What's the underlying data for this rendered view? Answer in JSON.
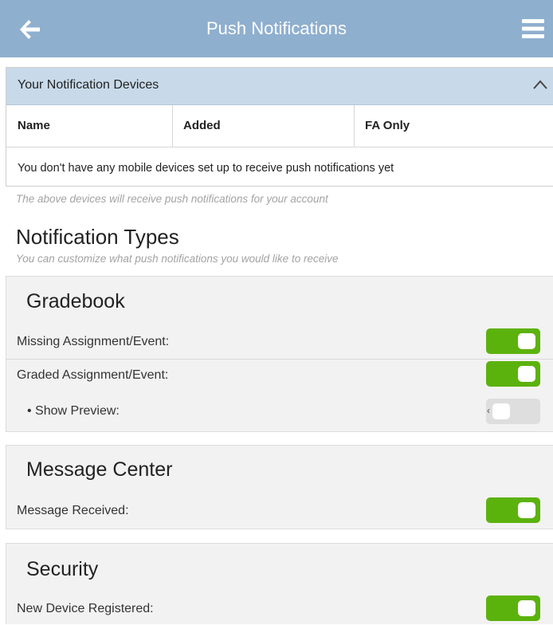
{
  "header": {
    "title": "Push Notifications",
    "back_icon": "arrow-left-icon",
    "menu_icon": "hamburger-menu-icon"
  },
  "devices": {
    "title": "Your Notification Devices",
    "columns": [
      "Name",
      "Added",
      "FA Only"
    ],
    "empty_message": "You don't have any mobile devices set up to receive push notifications yet",
    "note": "The above devices will receive push notifications for your account"
  },
  "notification_types": {
    "title": "Notification Types",
    "subtitle": "You can customize what push notifications you would like to receive"
  },
  "sections": {
    "gradebook": {
      "title": "Gradebook",
      "missing": {
        "label": "Missing Assignment/Event:",
        "enabled": true
      },
      "graded": {
        "label": "Graded Assignment/Event:",
        "enabled": true
      },
      "preview": {
        "label": "• Show Preview:",
        "enabled": false
      }
    },
    "message_center": {
      "title": "Message Center",
      "received": {
        "label": "Message Received:",
        "enabled": true
      }
    },
    "security": {
      "title": "Security",
      "new_device": {
        "label": "New Device Registered:",
        "enabled": true
      }
    }
  },
  "colors": {
    "header_bg": "#8fafcf",
    "panel_header_bg": "#c8daea",
    "toggle_on": "#5cb20d",
    "toggle_off": "#dedede"
  }
}
